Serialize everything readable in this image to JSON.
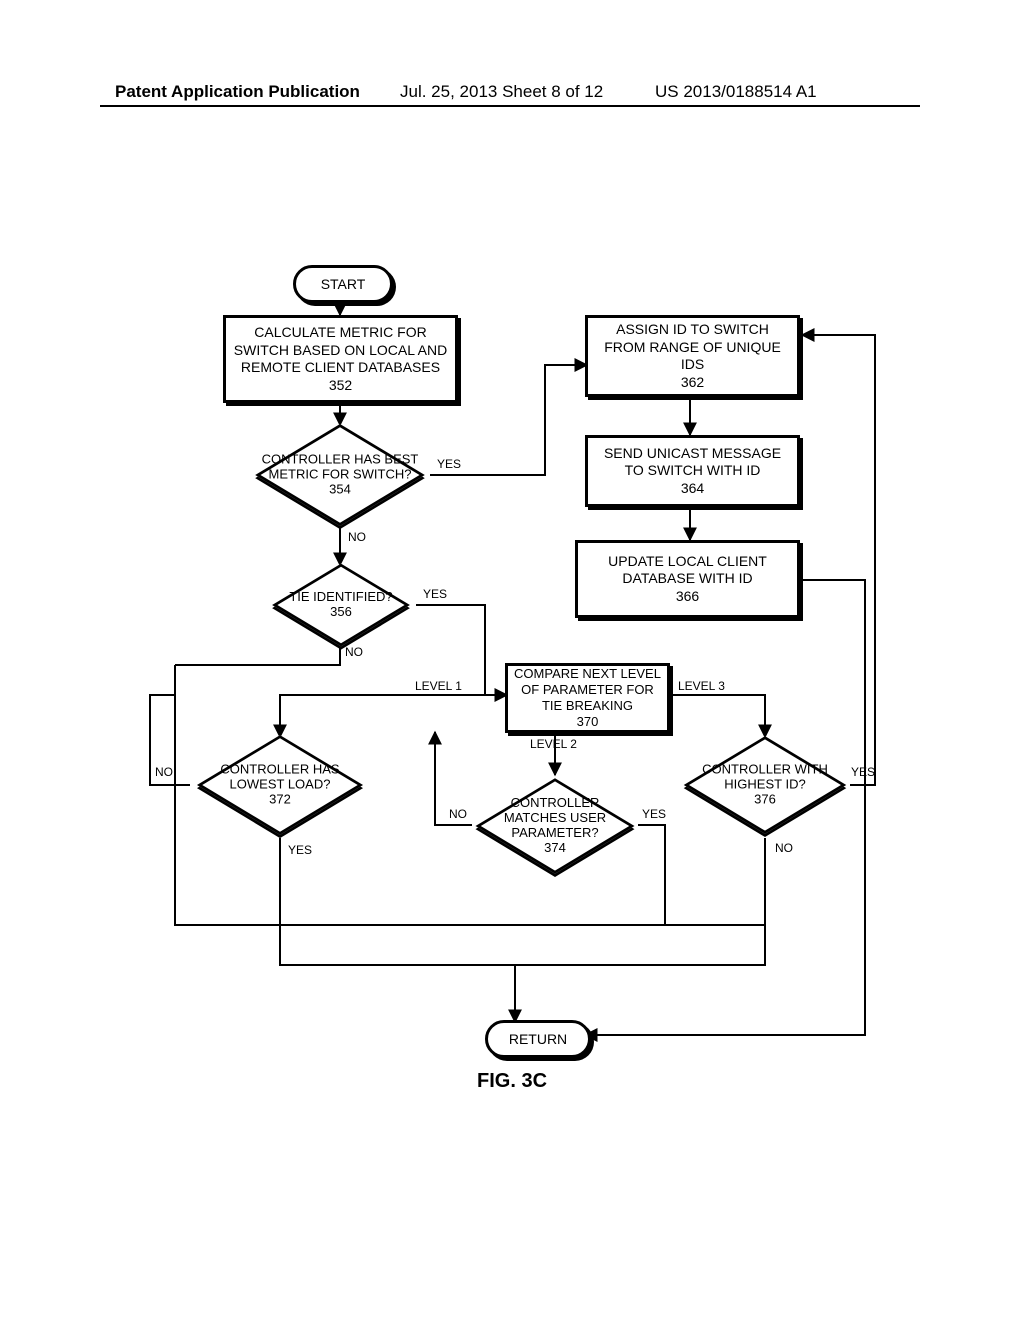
{
  "header": {
    "left": "Patent Application Publication",
    "center": "Jul. 25, 2013  Sheet 8 of 12",
    "right": "US 2013/0188514 A1"
  },
  "term": {
    "start": "START",
    "return": "RETURN"
  },
  "proc": {
    "b352": {
      "text": "CALCULATE METRIC FOR SWITCH BASED ON LOCAL AND REMOTE CLIENT DATABASES",
      "num": "352"
    },
    "b362": {
      "text": "ASSIGN ID TO SWITCH FROM RANGE OF UNIQUE IDS",
      "num": "362"
    },
    "b364": {
      "text": "SEND UNICAST MESSAGE TO SWITCH WITH ID",
      "num": "364"
    },
    "b366": {
      "text": "UPDATE LOCAL CLIENT DATABASE WITH ID",
      "num": "366"
    },
    "b370": {
      "text": "COMPARE NEXT LEVEL OF PARAMETER FOR TIE BREAKING",
      "num": "370"
    }
  },
  "dec": {
    "d354": {
      "text": "CONTROLLER HAS BEST METRIC FOR SWITCH?",
      "num": "354"
    },
    "d356": {
      "text": "TIE IDENTIFIED?",
      "num": "356"
    },
    "d372": {
      "text": "CONTROLLER HAS LOWEST LOAD?",
      "num": "372"
    },
    "d374": {
      "text": "CONTROLLER MATCHES USER PARAMETER?",
      "num": "374"
    },
    "d376": {
      "text": "CONTROLLER WITH HIGHEST ID?",
      "num": "376"
    }
  },
  "labels": {
    "yes": "YES",
    "no": "NO",
    "lvl1": "LEVEL 1",
    "lvl2": "LEVEL 2",
    "lvl3": "LEVEL 3"
  },
  "figure_caption": "FIG. 3C"
}
